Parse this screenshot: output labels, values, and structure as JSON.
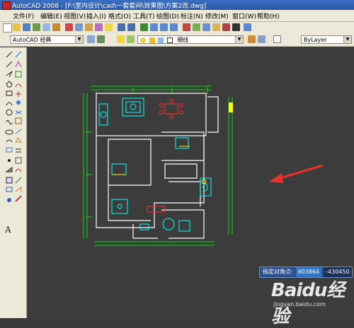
{
  "window": {
    "title": "AutoCAD 2008 - [F:\\室内设计\\cad\\一套套间\\效果图\\方案2改.dwg]"
  },
  "menu": [
    {
      "label": "文件(F)",
      "name": "menu-file"
    },
    {
      "label": "编辑(E)",
      "name": "menu-edit"
    },
    {
      "label": "视图(V)",
      "name": "menu-view"
    },
    {
      "label": "插入(I)",
      "name": "menu-insert"
    },
    {
      "label": "格式(O)",
      "name": "menu-format"
    },
    {
      "label": "工具(T)",
      "name": "menu-tools"
    },
    {
      "label": "绘图(D)",
      "name": "menu-draw"
    },
    {
      "label": "标注(N)",
      "name": "menu-dimension"
    },
    {
      "label": "修改(M)",
      "name": "menu-modify"
    },
    {
      "label": "窗口(W)",
      "name": "menu-window"
    },
    {
      "label": "帮助(H)",
      "name": "menu-help"
    }
  ],
  "workspace": {
    "value": "AutoCAD 经典"
  },
  "layer": {
    "value": "细线"
  },
  "linetype": {
    "value": "ByLayer"
  },
  "dynamic_input": {
    "label": "指定对角点:",
    "x_value": "603864",
    "y_value": "-430450"
  },
  "watermark": {
    "logo": "Baidu经验",
    "site": "jingyan.baidu.com"
  },
  "colors": {
    "drawing_bg": "#3c3c3c",
    "walls": "#ffffff",
    "dimensions": "#00ff00",
    "furniture": "#00ffff",
    "accent_red": "#ff2020",
    "arrow": "#e8312a"
  }
}
